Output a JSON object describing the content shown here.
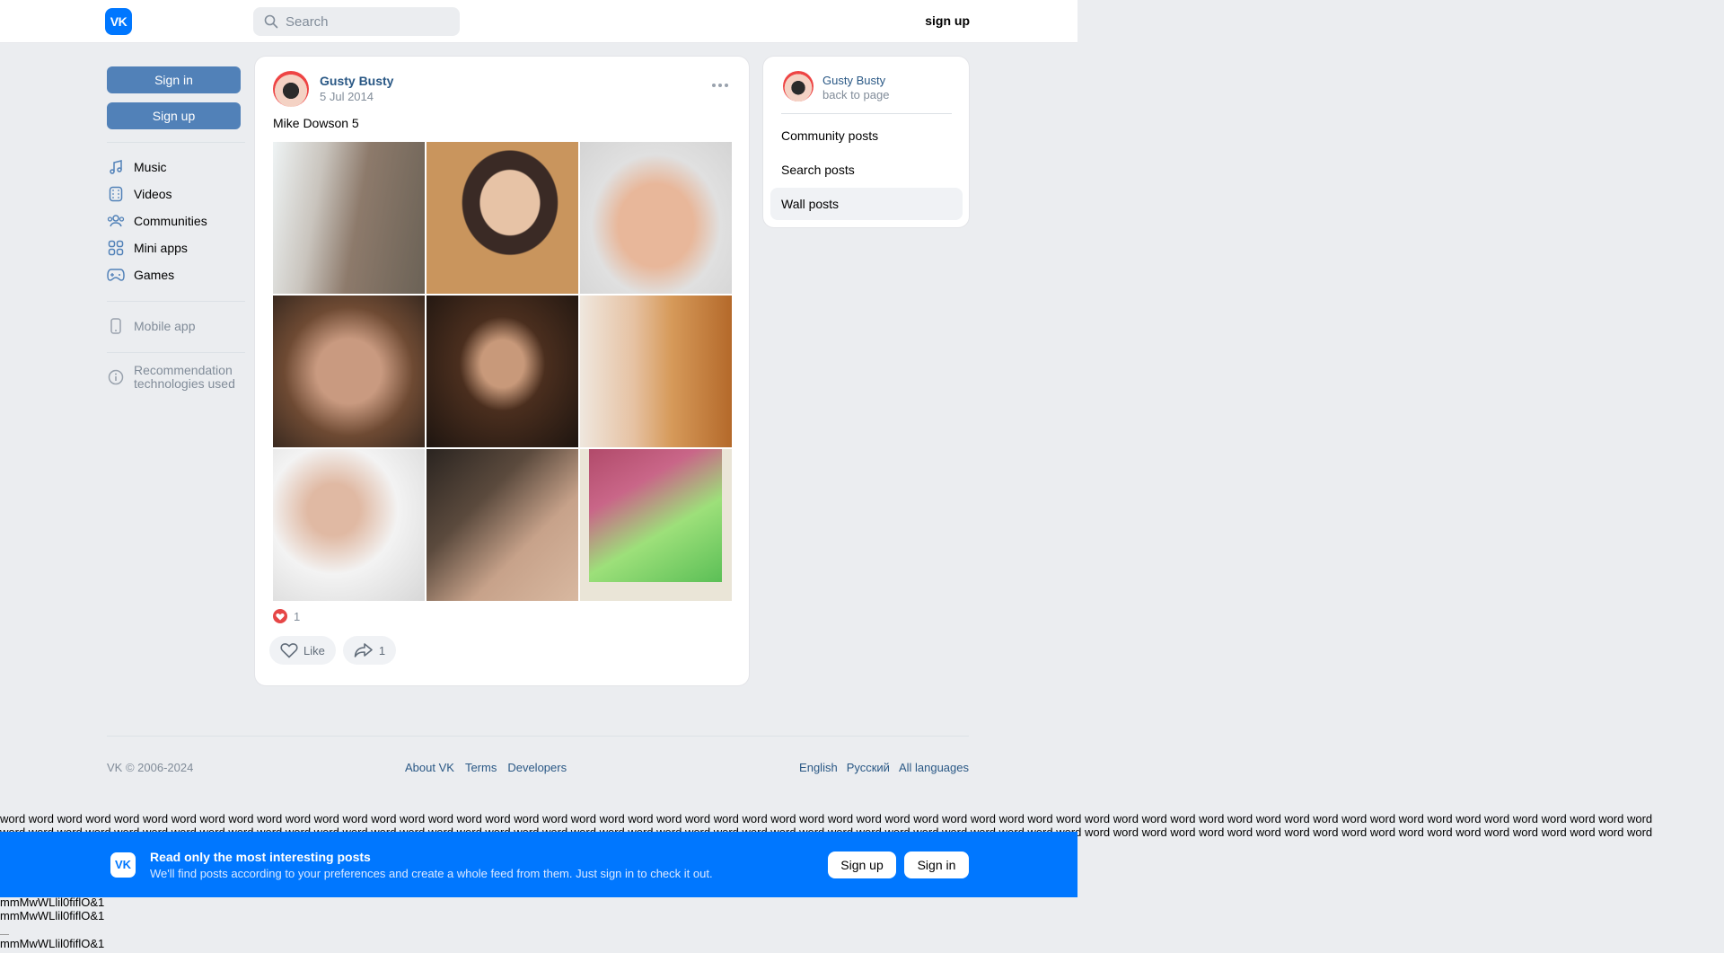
{
  "header": {
    "logo_text": "VK",
    "search_placeholder": "Search",
    "signup_label": "sign up"
  },
  "leftnav": {
    "signin_label": "Sign in",
    "signup_label": "Sign up",
    "items": [
      {
        "label": "Music",
        "icon": "music-icon"
      },
      {
        "label": "Videos",
        "icon": "video-icon"
      },
      {
        "label": "Communities",
        "icon": "communities-icon"
      },
      {
        "label": "Mini apps",
        "icon": "mini-apps-icon"
      },
      {
        "label": "Games",
        "icon": "gamepad-icon"
      }
    ],
    "mobile_app": "Mobile app",
    "recommendation": "Recommendation technologies used"
  },
  "post": {
    "author": "Gusty Busty",
    "date": "5 Jul 2014",
    "text": "Mike Dowson 5",
    "likes_count": "1",
    "like_label": "Like",
    "share_count": "1"
  },
  "right_card": {
    "name": "Gusty Busty",
    "back": "back to page",
    "items": [
      "Community posts",
      "Search posts",
      "Wall posts"
    ],
    "active_item": "Wall posts"
  },
  "footer": {
    "copyright": "VK © 2006-2024",
    "links": [
      "About VK",
      "Terms",
      "Developers"
    ],
    "langs": [
      "English",
      "Русский",
      "All languages"
    ]
  },
  "word_strip": "word word word word word word word word word word word word word word word word word word word word word word word word word word word word word word word word word word word word word word word word word word word word word word word word word word word word word word word word word word",
  "banner": {
    "logo_text": "VK",
    "title": "Read only the most interesting posts",
    "subtitle": "We'll find posts according to your preferences and create a whole feed from them. Just sign in to check it out.",
    "signup_label": "Sign up",
    "signin_label": "Sign in"
  },
  "debug_text": [
    "mmMwWLlil0fiflO&1",
    "mmMwWLlil0fiflO&1",
    "mmMwWLlil0fiflO&1"
  ],
  "colors": {
    "brand": "#0077ff",
    "link": "#2a5885",
    "button": "#5181b8",
    "background": "#ebedf0"
  }
}
